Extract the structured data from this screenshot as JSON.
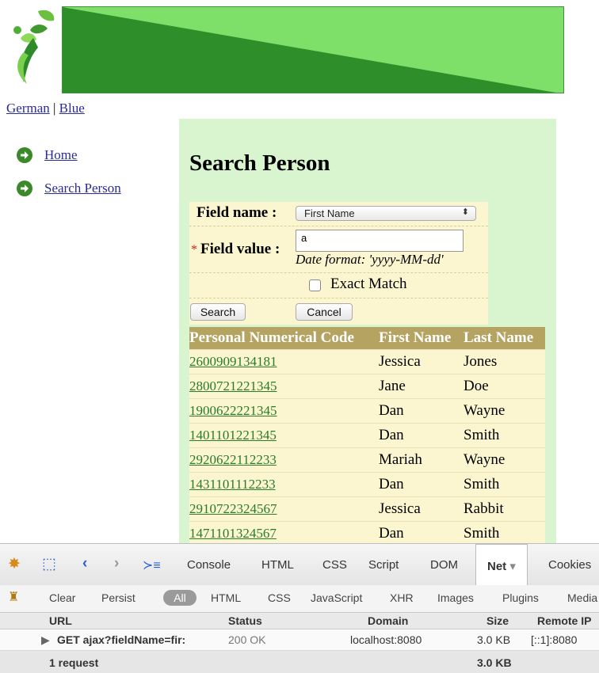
{
  "language_links": {
    "german": "German",
    "separator": "|",
    "blue": "Blue"
  },
  "nav": {
    "items": [
      {
        "label": "Home"
      },
      {
        "label": "Search Person"
      }
    ]
  },
  "page_title": "Search Person",
  "form": {
    "field_name_label": "Field name :",
    "field_name_value": "First Name",
    "required_marker": "*",
    "field_value_label": "Field value :",
    "field_value_input": "a",
    "date_hint": "Date format: 'yyyy-MM-dd'",
    "exact_match_label": "Exact Match",
    "exact_match_checked": false,
    "search_button": "Search",
    "cancel_button": "Cancel"
  },
  "results": {
    "headers": [
      "Personal Numerical Code",
      "First Name",
      "Last Name"
    ],
    "rows": [
      [
        "2600909134181",
        "Jessica",
        "Jones"
      ],
      [
        "2800721221345",
        "Jane",
        "Doe"
      ],
      [
        "1900622221345",
        "Dan",
        "Wayne"
      ],
      [
        "1401101221345",
        "Dan",
        "Smith"
      ],
      [
        "2920622112233",
        "Mariah",
        "Wayne"
      ],
      [
        "1431101112233",
        "Dan",
        "Smith"
      ],
      [
        "2910722324567",
        "Jessica",
        "Rabbit"
      ],
      [
        "1471101324567",
        "Dan",
        "Smith"
      ]
    ]
  },
  "devtools": {
    "tabs": [
      "Console",
      "HTML",
      "CSS",
      "Script",
      "DOM",
      "Net",
      "Cookies"
    ],
    "active_tab": "Net",
    "active_tab_arrow": "▾",
    "net_toolbar": {
      "clear": "Clear",
      "persist": "Persist",
      "filters": [
        "All",
        "HTML",
        "CSS",
        "JavaScript",
        "XHR",
        "Images",
        "Plugins",
        "Media"
      ]
    },
    "columns": [
      "URL",
      "Status",
      "Domain",
      "Size",
      "Remote IP"
    ],
    "request": {
      "url": "GET ajax?fieldName=fir:",
      "status": "200 OK",
      "domain": "localhost:8080",
      "size": "3.0 KB",
      "remote_ip": "[::1]:8080"
    },
    "footer": {
      "count": "1 request",
      "total_size": "3.0 KB"
    }
  },
  "colors": {
    "banner_dark": "#2e8f2a",
    "banner_light": "#7ee068",
    "content_bg": "#d8f5d0",
    "form_bg": "#fbf6cf",
    "table_header_bg": "#b5a461",
    "link_color": "#2a7a2a"
  }
}
